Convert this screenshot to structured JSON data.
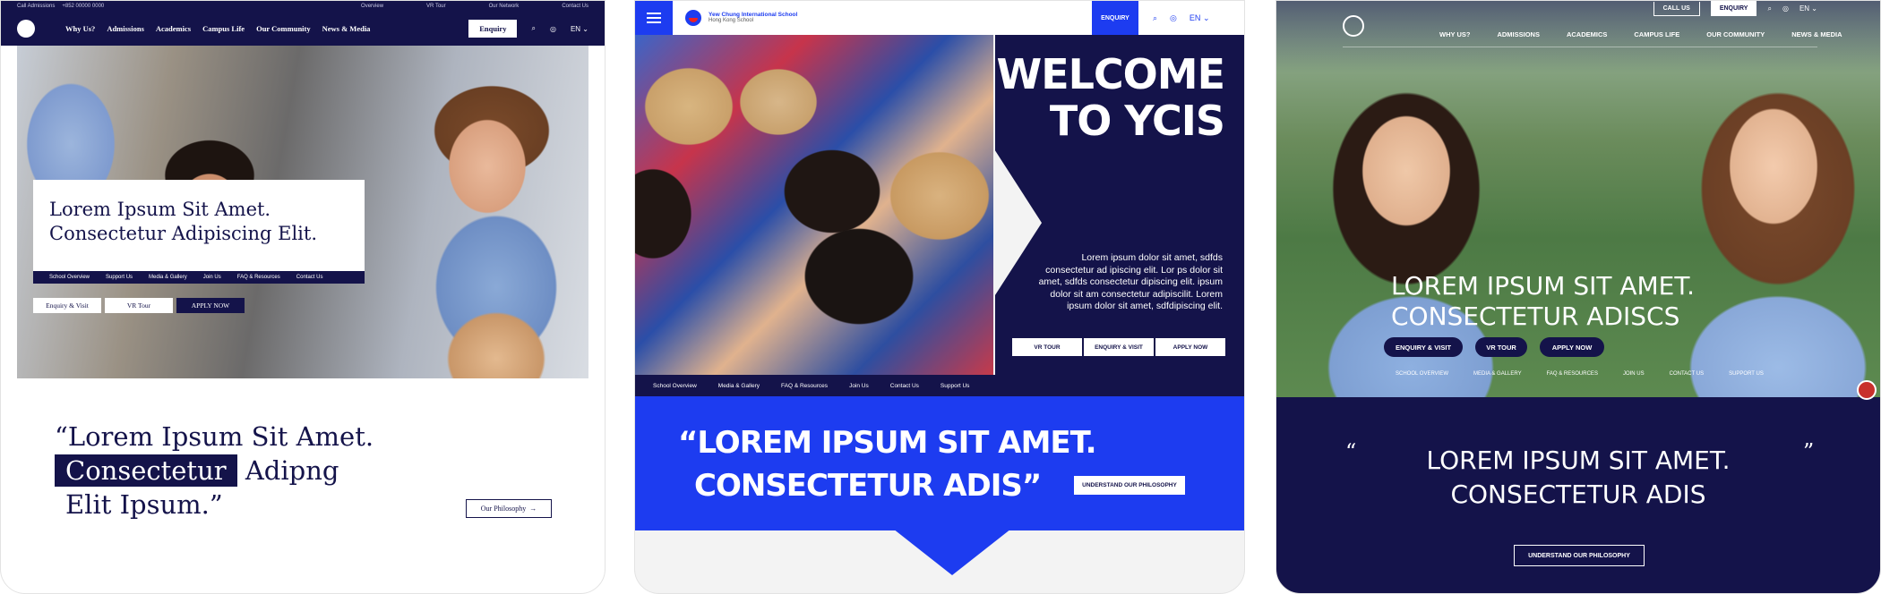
{
  "frame1": {
    "topbar": {
      "left_label": "Call Admissions",
      "phone": "+852 00000 0000",
      "links": [
        "Overview",
        "VR Tour",
        "Our Network",
        "Contact Us"
      ]
    },
    "nav": {
      "links": [
        "Why Us?",
        "Admissions",
        "Academics",
        "Campus Life",
        "Our Community",
        "News & Media"
      ],
      "enquiry": "Enquiry",
      "lang": "EN"
    },
    "hero": {
      "line1": "Lorem Ipsum Sit Amet.",
      "line2": "Consectetur Adipiscing Elit."
    },
    "quick_links": [
      "School Overview",
      "Support Us",
      "Media & Gallery",
      "Join Us",
      "FAQ & Resources",
      "Contact Us"
    ],
    "ctas": [
      "Enquiry & Visit",
      "VR Tour",
      "APPLY NOW"
    ],
    "quote": {
      "line1": "“Lorem Ipsum Sit Amet.",
      "highlight": "Consectetur",
      "rest": "Adipng",
      "line3": "Elit Ipsum.”"
    },
    "philosophy": "Our Philosophy"
  },
  "frame2": {
    "school_name": "Yew Chung International School",
    "school_sub": "Hong Kong School",
    "enquiry": "ENQUIRY",
    "lang": "EN",
    "welcome1": "WELCOME",
    "welcome2": "TO YCIS",
    "paragraph": "Lorem ipsum dolor sit amet, sdfds consectetur ad ipiscing elit. Lor ps dolor sit amet, sdfds consectetur dipiscing elit. ipsum dolor sit am consectetur adipiscilit. Lorem ipsum dolor sit amet, sdfdipiscing elit.",
    "ctas": [
      "VR TOUR",
      "ENQUIRY & VISIT",
      "APPLY NOW"
    ],
    "quick_links": [
      "School Overview",
      "Media & Gallery",
      "FAQ & Resources",
      "Join Us",
      "Contact Us",
      "Support Us"
    ],
    "quote": {
      "line1": "“LOREM IPSUM SIT AMET.",
      "line2": "CONSECTETUR ADIS”"
    },
    "philosophy": "UNDERSTAND OUR PHILOSOPHY"
  },
  "frame3": {
    "call_us": "CALL US",
    "enquiry": "ENQUIRY",
    "lang": "EN",
    "nav": [
      "WHY US?",
      "ADMISSIONS",
      "ACADEMICS",
      "CAMPUS LIFE",
      "OUR COMMUNITY",
      "NEWS & MEDIA"
    ],
    "headline1": "LOREM IPSUM SIT AMET.",
    "headline2": "CONSECTETUR ADISCS",
    "pills": [
      "ENQUIRY & VISIT",
      "VR TOUR",
      "APPLY NOW"
    ],
    "quick_links": [
      "SCHOOL OVERVIEW",
      "MEDIA & GALLERY",
      "FAQ & RESOURCES",
      "JOIN US",
      "CONTACT US",
      "SUPPORT US"
    ],
    "open_quote": "“",
    "close_quote": "”",
    "quote1": "LOREM IPSUM SIT AMET.",
    "quote2": "CONSECTETUR ADIS",
    "philosophy": "UNDERSTAND OUR PHILOSOPHY"
  },
  "icons": {
    "search": "⌕",
    "user": "◎",
    "chevron": "⌄",
    "arrow": "→"
  },
  "colors": {
    "navy": "#14134a",
    "royal_blue": "#1d3cf0",
    "white": "#ffffff"
  }
}
